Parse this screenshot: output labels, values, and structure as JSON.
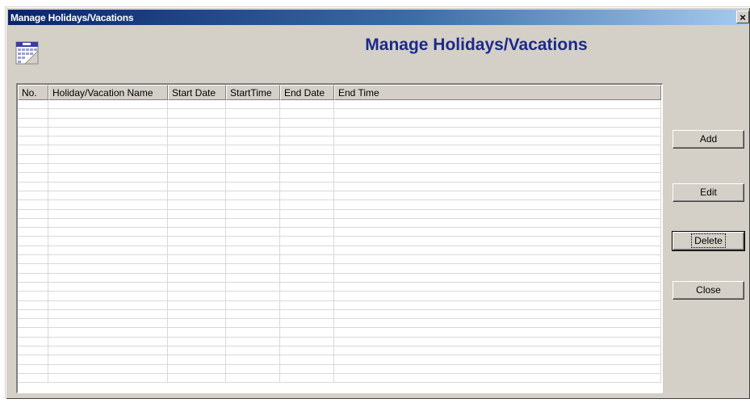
{
  "window": {
    "title": "Manage Holidays/Vacations",
    "close_glyph": "×"
  },
  "header": {
    "heading": "Manage Holidays/Vacations",
    "icon": "calendar-icon"
  },
  "table": {
    "columns": [
      "No.",
      "Holiday/Vacation Name",
      "Start Date",
      "StartTime",
      "End Date",
      "End Time"
    ],
    "rows": []
  },
  "buttons": {
    "add": "Add",
    "edit": "Edit",
    "delete": "Delete",
    "close": "Close"
  },
  "colors": {
    "heading": "#1c2a8c",
    "titlebar_start": "#0a246a",
    "titlebar_end": "#a6caf0",
    "dialog_bg": "#d4d0c8"
  }
}
